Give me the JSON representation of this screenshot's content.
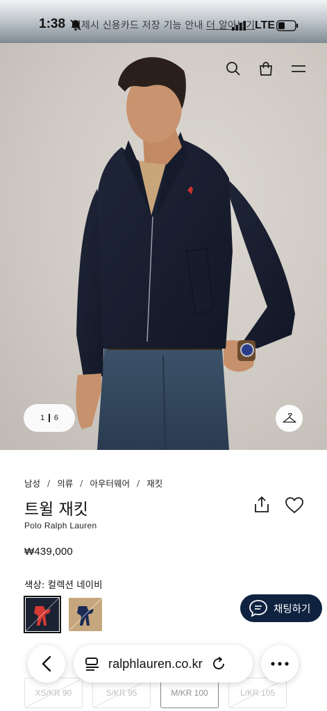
{
  "status_bar": {
    "time": "1:38",
    "network": "LTE",
    "banner_text": "결제시 신용카드 저장 기능 안내",
    "banner_link": "더 알아보기"
  },
  "hero": {
    "pager_current": "1",
    "pager_total": "6"
  },
  "product": {
    "breadcrumb": [
      "남성",
      "의류",
      "아우터웨어",
      "재킷"
    ],
    "title": "트윌 재킷",
    "brand": "Polo Ralph Lauren",
    "price": "₩439,000",
    "color_label": "색상: 컬렉션 네이비",
    "swatches": [
      {
        "name": "navy",
        "bg": "#1b2333",
        "pony": "#d63a35",
        "selected": true
      },
      {
        "name": "tan",
        "bg": "#c6a67c",
        "pony": "#1b2a55",
        "selected": false
      }
    ]
  },
  "sizes": [
    "XS/KR 90",
    "S/KR 95",
    "M/KR 100",
    "L/KR 105"
  ],
  "chat": {
    "label": "채팅하기"
  },
  "browser": {
    "url": "ralphlauren.co.kr"
  },
  "colors": {
    "chat_bg": "#0f2340",
    "accent_red": "#c8322c"
  }
}
